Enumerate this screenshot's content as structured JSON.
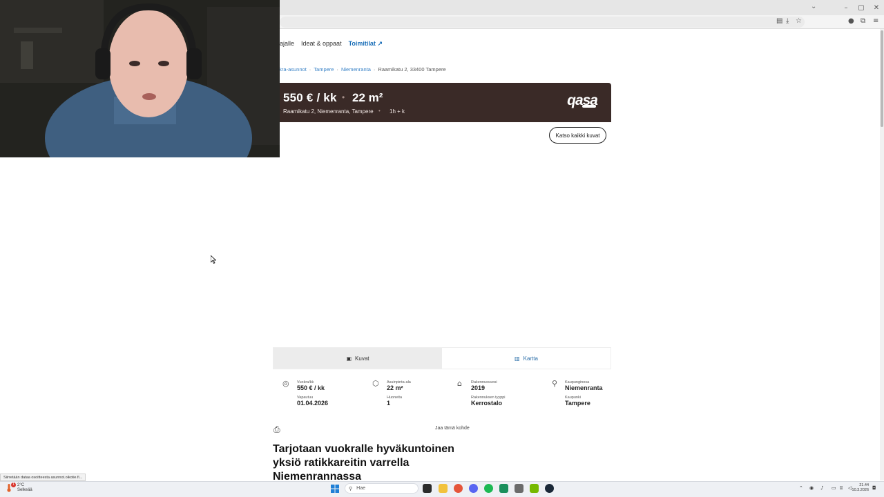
{
  "browser": {
    "toolbar_icons": [
      "reader-icon",
      "download-icon",
      "star-icon",
      "account-icon",
      "extensions-icon",
      "menu-icon"
    ]
  },
  "site_nav": {
    "items": [
      "ajalle",
      "Ideat & oppaat"
    ],
    "active": "Toimitilat"
  },
  "breadcrumb": {
    "items": [
      "okra-asunnot",
      "Tampere",
      "Niemenranta"
    ],
    "current": "Raamikatu 2, 33400 Tampere"
  },
  "hero": {
    "price": "550 € / kk",
    "area": "22 m²",
    "address": "Raamikatu 2, Niemenranta, Tampere",
    "rooms": "1h + k",
    "brand": "qasa",
    "bg_color": "#3a2a27"
  },
  "gallery": {
    "view_all_label": "Katso kaikki kuvat"
  },
  "view_tabs": {
    "pictures": "Kuvat",
    "map": "Kartta"
  },
  "facts": {
    "rent_label": "Vuokra/kk",
    "rent_value": "550 € / kk",
    "available_label": "Vapautuu",
    "available_value": "01.04.2026",
    "area_label": "Asuinpinta-ala",
    "area_value": "22 m²",
    "rooms_label": "Huoneita",
    "rooms_value": "1",
    "built_label": "Rakennusvuosi",
    "built_value": "2019",
    "building_type_label": "Rakennuksen tyyppi",
    "building_type_value": "Kerrostalo",
    "district_label": "Kaupunginosa",
    "district_value": "Niemenranta",
    "city_label": "Kaupunki",
    "city_value": "Tampere"
  },
  "actions": {
    "share": "Jaa tämä kohde"
  },
  "listing": {
    "headline": "Tarjotaan vuokralle hyväkuntoinen yksiö ratikkareitin varrella Niemenrannassa"
  },
  "status_bar": {
    "text": "Siirretään dataa osoitteesta asunnot.oikotie.fi..."
  },
  "taskbar": {
    "weather_temp": "2°C",
    "weather_desc": "Selkeää",
    "weather_badge": "1",
    "search_placeholder": "Hae",
    "time": "21.44",
    "date": "10.3.2026"
  }
}
